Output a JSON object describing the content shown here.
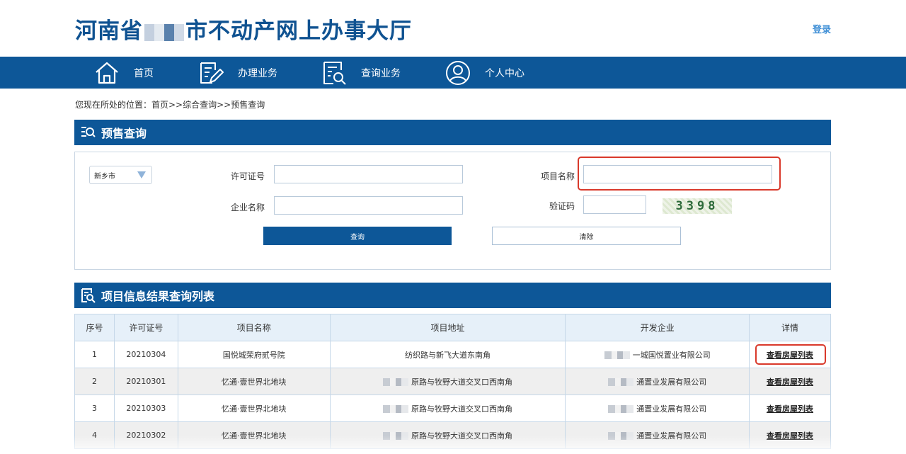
{
  "header": {
    "title_prefix": "河南省",
    "title_suffix": "市不动产网上办事大厅",
    "login_label": "登录"
  },
  "nav": {
    "items": [
      {
        "label": "首页",
        "icon": "home-icon"
      },
      {
        "label": "办理业务",
        "icon": "edit-document-icon"
      },
      {
        "label": "查询业务",
        "icon": "search-document-icon"
      },
      {
        "label": "个人中心",
        "icon": "user-icon"
      }
    ]
  },
  "breadcrumb": "您现在所处的位置：首页>>综合查询>>预售查询",
  "presale": {
    "section_title": "预售查询",
    "city_value": "新乡市",
    "permit_label": "许可证号",
    "permit_value": "",
    "project_label": "项目名称",
    "project_value": "",
    "company_label": "企业名称",
    "company_value": "",
    "captcha_label": "验证码",
    "captcha_value": "",
    "captcha_text": "3398",
    "query_button": "查询",
    "clear_button": "清除"
  },
  "results": {
    "section_title": "项目信息结果查询列表",
    "columns": [
      "序号",
      "许可证号",
      "项目名称",
      "项目地址",
      "开发企业",
      "详情"
    ],
    "rows": [
      {
        "index": "1",
        "permit": "20210304",
        "name": "国悦城荣府贰号院",
        "address": "纺织路与新飞大道东南角",
        "developer": "一城国悦置业有限公司",
        "link": "查看房屋列表"
      },
      {
        "index": "2",
        "permit": "20210301",
        "name": "忆通·壹世界北地块",
        "address": "原路与牧野大道交叉口西南角",
        "developer": "通置业发展有限公司",
        "link": "查看房屋列表"
      },
      {
        "index": "3",
        "permit": "20210303",
        "name": "忆通·壹世界北地块",
        "address": "原路与牧野大道交叉口西南角",
        "developer": "通置业发展有限公司",
        "link": "查看房屋列表"
      },
      {
        "index": "4",
        "permit": "20210302",
        "name": "忆通·壹世界北地块",
        "address": "原路与牧野大道交叉口西南角",
        "developer": "通置业发展有限公司",
        "link": "查看房屋列表"
      }
    ]
  },
  "colors": {
    "brand_blue": "#0d5798",
    "title_blue": "#0f5291",
    "highlight_red": "#d9392b"
  }
}
